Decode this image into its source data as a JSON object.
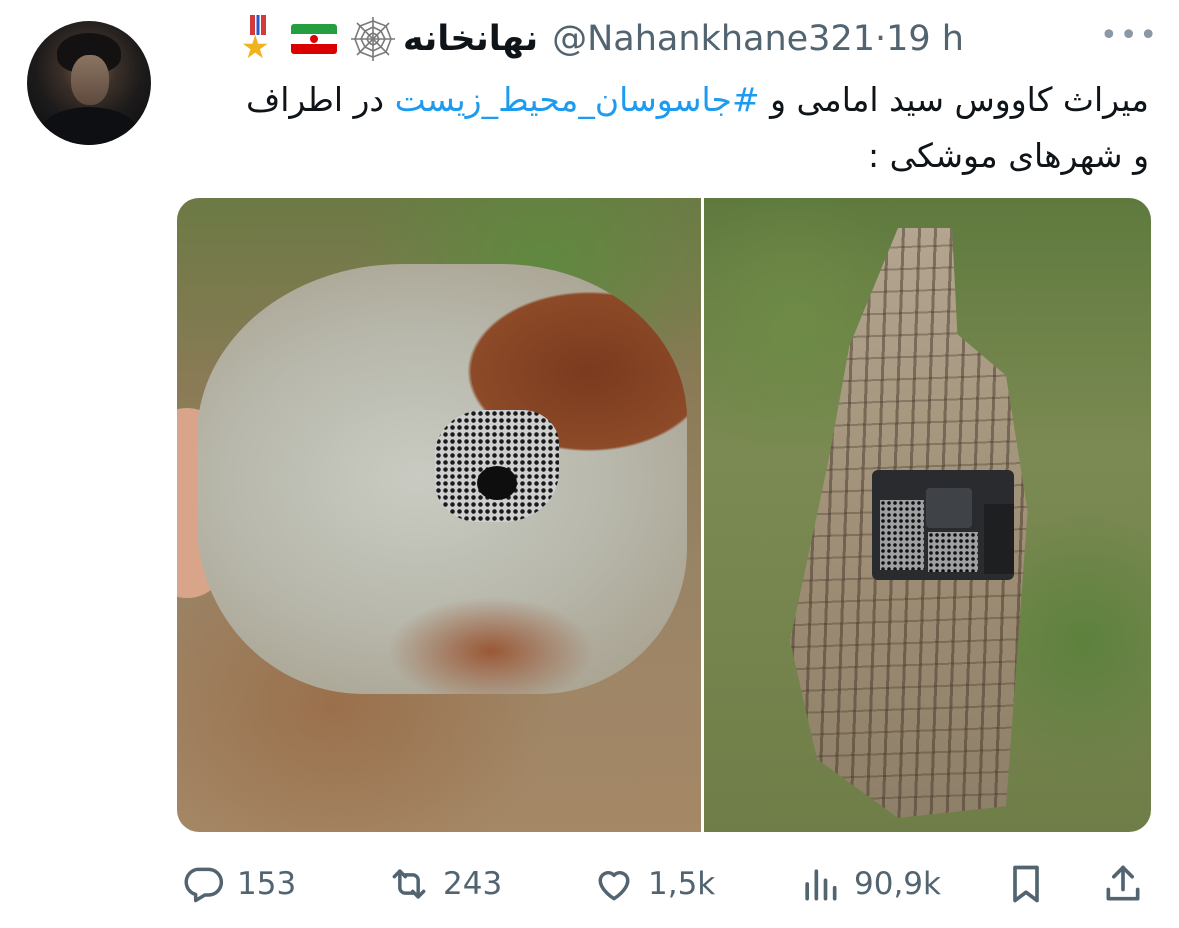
{
  "author": {
    "display_name": "نهانخانه",
    "handle": "@Nahankhane321",
    "separator": "·",
    "time": "19 h",
    "badges": [
      "medal-emoji",
      "iran-flag-emoji",
      "spider-web-emoji"
    ]
  },
  "more_label": "•••",
  "tweet": {
    "part1": "میراث کاووس سید امامی و ",
    "hashtag": "#جاسوسان_محیط_زیست",
    "part2": " در اطراف و شهرهای موشکی :"
  },
  "media": [
    {
      "icon": "photo-rock-device"
    },
    {
      "icon": "photo-bark-camera"
    }
  ],
  "actions": {
    "replies": "153",
    "retweets": "243",
    "likes": "1,5k",
    "views": "90,9k"
  },
  "colors": {
    "link": "#1d9bf0",
    "text": "#0f1419",
    "muted": "#536471"
  }
}
